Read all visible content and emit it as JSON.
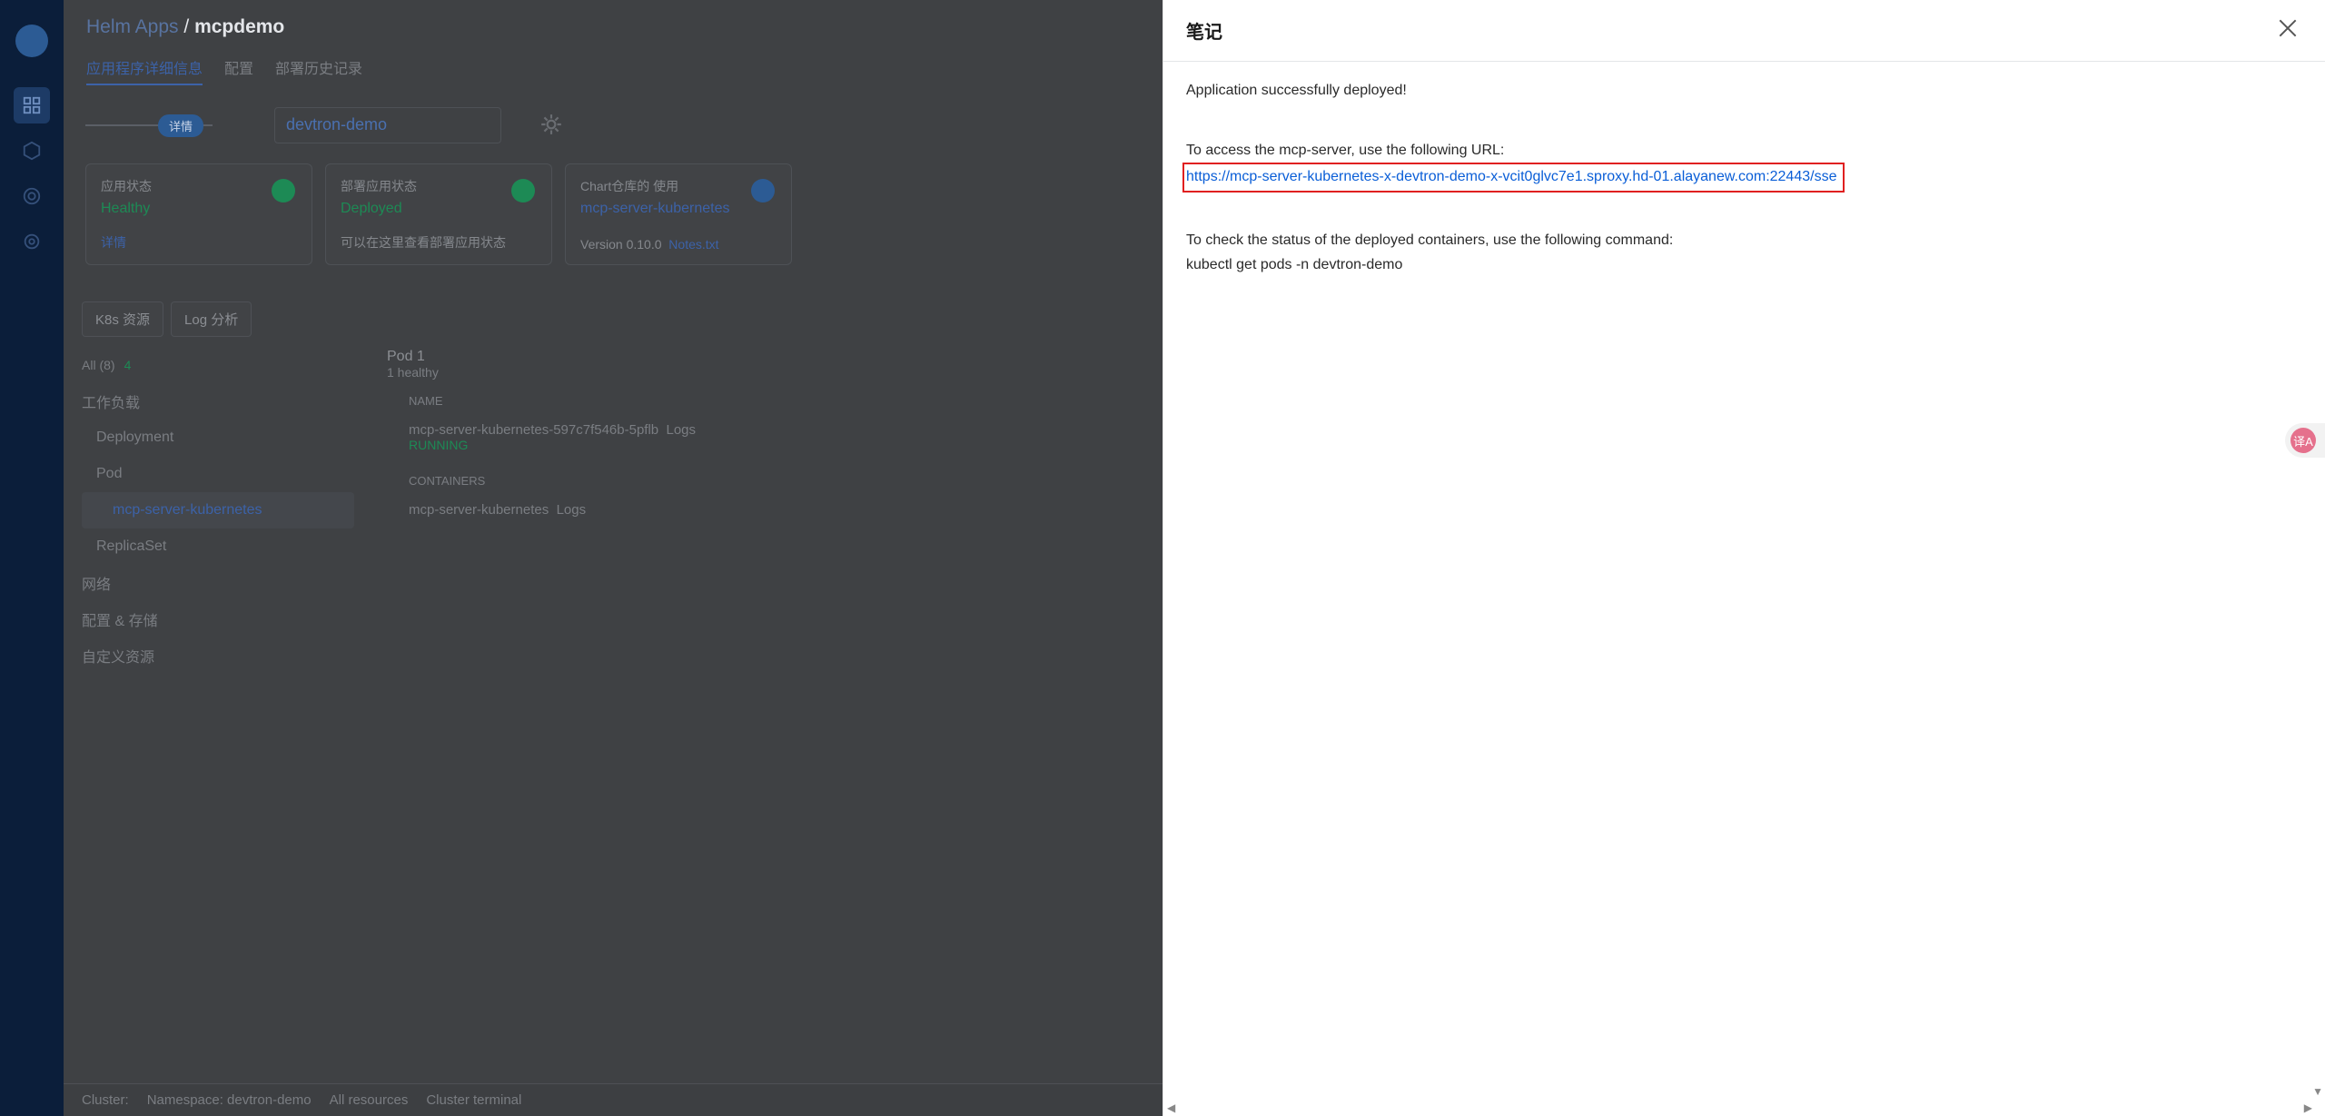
{
  "app": {
    "breadcrumb_root": "Helm Apps",
    "breadcrumb_sep": " / ",
    "breadcrumb_app": "mcpdemo",
    "tabs": [
      "应用程序详细信息",
      "配置",
      "部署历史记录"
    ],
    "env_pill": "详情",
    "namespace": "devtron-demo",
    "cards": [
      {
        "label": "应用状态",
        "value": "Healthy",
        "footer": "详情",
        "color": "#1d8a55"
      },
      {
        "label": "部署应用状态",
        "value": "Deployed",
        "footer": "可以在这里查看部署应用状态",
        "color": "#1d8a55"
      },
      {
        "label": "Chart仓库的 使用",
        "value": "mcp-server-kubernetes",
        "footer": "Version 0.10.0",
        "footer_link": "Notes.txt",
        "color": "#2c5b94"
      }
    ],
    "sub_tabs": [
      "K8s 资源",
      "Log 分析"
    ],
    "filter_all": "All (8)",
    "filter_healthy": "4",
    "tree": [
      "工作负载",
      "Deployment",
      "Pod",
      "mcp-server-kubernetes",
      "ReplicaSet",
      "网络",
      "配置 & 存储",
      "自定义资源"
    ],
    "pod": {
      "title": "Pod",
      "count": "1",
      "healthy": "1 healthy",
      "name_header": "NAME",
      "pod_name": "mcp-server-kubernetes-597c7f546b-5pflb",
      "pod_status": "RUNNING",
      "logs": "Logs",
      "containers_header": "CONTAINERS",
      "container_name": "mcp-server-kubernetes"
    },
    "statusbar": {
      "cluster": "Cluster:",
      "namespace": "Namespace: devtron-demo",
      "all_resources": "All resources",
      "terminal": "Cluster terminal"
    }
  },
  "drawer": {
    "title": "笔记",
    "line1": "Application successfully deployed!",
    "line2": "To access the mcp-server, use the following URL:",
    "url": "https://mcp-server-kubernetes-x-devtron-demo-x-vcit0glvc7e1.sproxy.hd-01.alayanew.com:22443/sse",
    "line3": "To check the status of the deployed containers, use the following command:",
    "line4": "kubectl get pods -n devtron-demo",
    "translate_icon": "译A"
  },
  "colors": {
    "accent": "#0a5ed7",
    "highlight": "#e02020",
    "rail": "#0b1e3a"
  }
}
